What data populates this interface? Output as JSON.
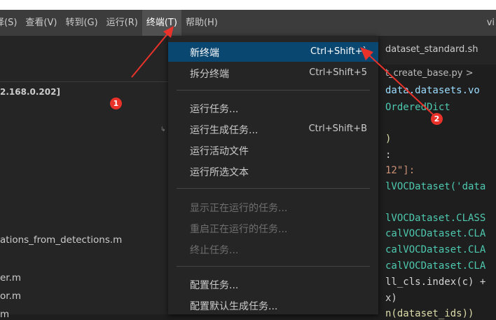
{
  "menubar": {
    "items": [
      {
        "label": "择(S)"
      },
      {
        "label": "查看(V)"
      },
      {
        "label": "转到(G)"
      },
      {
        "label": "运行(R)"
      },
      {
        "label": "终端(T)"
      },
      {
        "label": "帮助(H)"
      }
    ],
    "title_fragment": "vi"
  },
  "sidebar": {
    "host": "2.168.0.202]",
    "files": [
      "ations_from_detections.m",
      "er.m",
      "or.m",
      "m"
    ],
    "glyph": "↳"
  },
  "editor": {
    "tab_label": "dataset_standard.sh",
    "breadcrumb": "t_create_base.py >",
    "code_lines": [
      {
        "text": "data.datasets.vo",
        "color": "blue"
      },
      {
        "text": "OrderedDict",
        "color": "teal"
      },
      {
        "text": ")",
        "color": "yellow"
      },
      {
        "text": ":",
        "color": "white"
      },
      {
        "text": "12\"]:",
        "color": "str"
      },
      {
        "text": "lVOCDataset('data",
        "color": "teal"
      },
      {
        "text": "lVOCDataset.CLASS",
        "color": "teal"
      },
      {
        "text": "calVOCDataset.CLA",
        "color": "teal"
      },
      {
        "text": "calVOCDataset.CLA",
        "color": "teal"
      },
      {
        "text": "calVOCDataset.CLA",
        "color": "teal"
      },
      {
        "text": "ll_cls.index(c) +",
        "color": "white"
      },
      {
        "text": "x)",
        "color": "white"
      },
      {
        "text": "n(dataset_ids))",
        "color": "yellow"
      }
    ]
  },
  "dropdown": {
    "items": [
      {
        "label": "新终端",
        "shortcut": "Ctrl+Shift+`"
      },
      {
        "label": "拆分终端",
        "shortcut": "Ctrl+Shift+5"
      },
      {
        "label": "运行任务...",
        "shortcut": ""
      },
      {
        "label": "运行生成任务...",
        "shortcut": "Ctrl+Shift+B"
      },
      {
        "label": "运行活动文件",
        "shortcut": ""
      },
      {
        "label": "运行所选文本",
        "shortcut": ""
      },
      {
        "label": "显示正在运行的任务...",
        "shortcut": ""
      },
      {
        "label": "重启正在运行的任务...",
        "shortcut": ""
      },
      {
        "label": "终止任务...",
        "shortcut": ""
      },
      {
        "label": "配置任务...",
        "shortcut": ""
      },
      {
        "label": "配置默认生成任务...",
        "shortcut": ""
      }
    ]
  },
  "annotations": {
    "badge1": "1",
    "badge2": "2"
  },
  "colors": {
    "menubar": "#3c3c3c",
    "highlight": "#094771",
    "annotation": "#e8322a"
  }
}
